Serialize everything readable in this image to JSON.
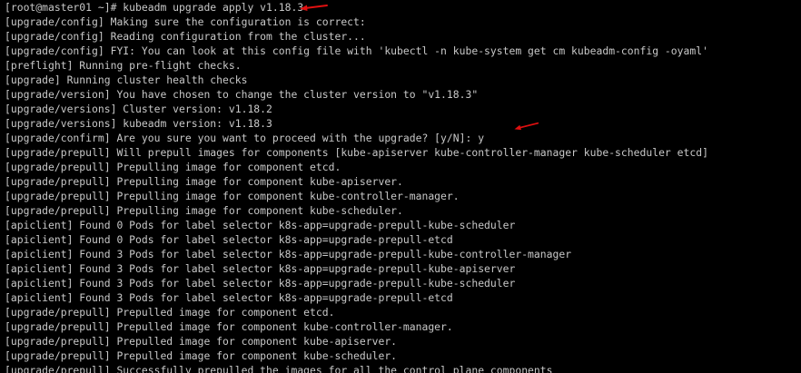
{
  "terminal": {
    "lines": [
      "[root@master01 ~]# kubeadm upgrade apply v1.18.3",
      "[upgrade/config] Making sure the configuration is correct:",
      "[upgrade/config] Reading configuration from the cluster...",
      "[upgrade/config] FYI: You can look at this config file with 'kubectl -n kube-system get cm kubeadm-config -oyaml'",
      "[preflight] Running pre-flight checks.",
      "[upgrade] Running cluster health checks",
      "[upgrade/version] You have chosen to change the cluster version to \"v1.18.3\"",
      "[upgrade/versions] Cluster version: v1.18.2",
      "[upgrade/versions] kubeadm version: v1.18.3",
      "[upgrade/confirm] Are you sure you want to proceed with the upgrade? [y/N]: y",
      "[upgrade/prepull] Will prepull images for components [kube-apiserver kube-controller-manager kube-scheduler etcd]",
      "[upgrade/prepull] Prepulling image for component etcd.",
      "[upgrade/prepull] Prepulling image for component kube-apiserver.",
      "[upgrade/prepull] Prepulling image for component kube-controller-manager.",
      "[upgrade/prepull] Prepulling image for component kube-scheduler.",
      "[apiclient] Found 0 Pods for label selector k8s-app=upgrade-prepull-kube-scheduler",
      "[apiclient] Found 0 Pods for label selector k8s-app=upgrade-prepull-etcd",
      "[apiclient] Found 3 Pods for label selector k8s-app=upgrade-prepull-kube-controller-manager",
      "[apiclient] Found 3 Pods for label selector k8s-app=upgrade-prepull-kube-apiserver",
      "[apiclient] Found 3 Pods for label selector k8s-app=upgrade-prepull-kube-scheduler",
      "[apiclient] Found 3 Pods for label selector k8s-app=upgrade-prepull-etcd",
      "[upgrade/prepull] Prepulled image for component etcd.",
      "[upgrade/prepull] Prepulled image for component kube-controller-manager.",
      "[upgrade/prepull] Prepulled image for component kube-apiserver.",
      "[upgrade/prepull] Prepulled image for component kube-scheduler.",
      "[upgrade/prepull] Successfully prepulled the images for all the control plane components"
    ],
    "annotation_color": "#e01010",
    "text_color": "#c8c8c8",
    "background_color": "#000000"
  }
}
